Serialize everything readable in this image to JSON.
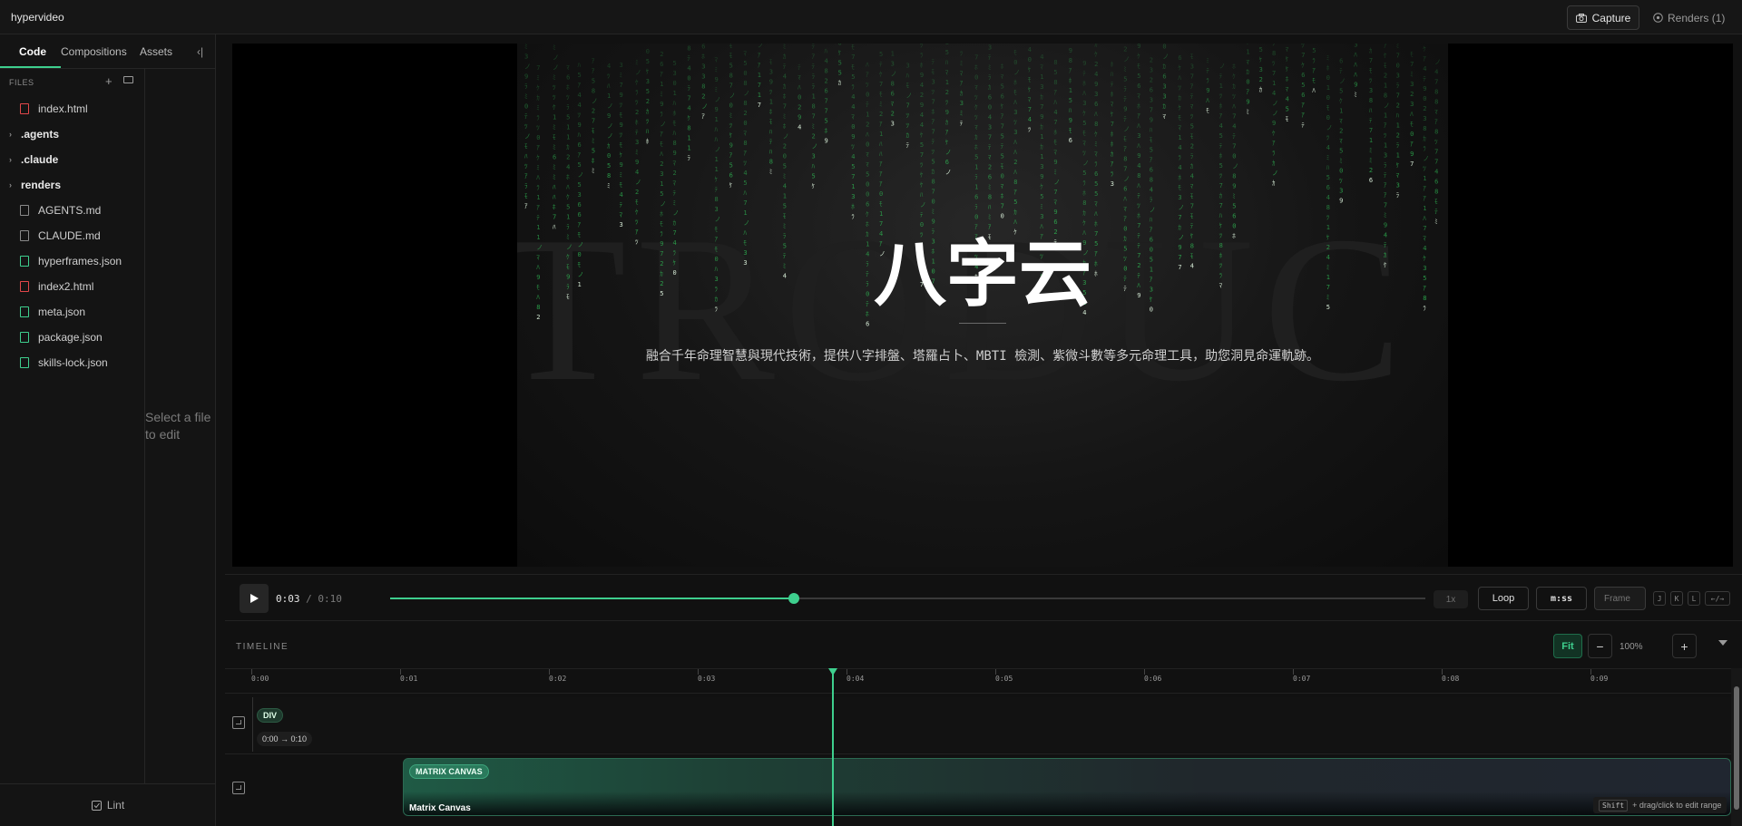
{
  "app": {
    "title": "hypervideo"
  },
  "header": {
    "capture_label": "Capture",
    "renders_label": "Renders (1)"
  },
  "sidebar": {
    "tabs": [
      {
        "label": "Code",
        "active": true
      },
      {
        "label": "Compositions",
        "active": false
      },
      {
        "label": "Assets",
        "active": false
      }
    ],
    "files_header": "FILES",
    "files": [
      {
        "name": "index.html",
        "kind": "html"
      },
      {
        "name": ".agents",
        "kind": "folder"
      },
      {
        "name": ".claude",
        "kind": "folder"
      },
      {
        "name": "renders",
        "kind": "folder"
      },
      {
        "name": "AGENTS.md",
        "kind": "md"
      },
      {
        "name": "CLAUDE.md",
        "kind": "md"
      },
      {
        "name": "hyperframes.json",
        "kind": "json"
      },
      {
        "name": "index2.html",
        "kind": "html"
      },
      {
        "name": "meta.json",
        "kind": "json"
      },
      {
        "name": "package.json",
        "kind": "json"
      },
      {
        "name": "skills-lock.json",
        "kind": "json"
      }
    ],
    "empty_editor_message": "Select a file to edit",
    "lint_label": "Lint"
  },
  "preview": {
    "background_word": "TRODUC",
    "heading": "八字云",
    "subtitle": "融合千年命理智慧與現代技術，提供八字排盤、塔羅占卜、MBTI 檢測、紫微斗數等多元命理工具，助您洞見命運軌跡。",
    "rain_glyphs": "5ノ7ｱｶﾊ012ﾐﾓ3ﾗ8ﾂ4ﾎﾃ69ﾏｹ"
  },
  "playback": {
    "current_time": "0:03",
    "separator": "/",
    "total_time": "0:10",
    "progress": 0.39,
    "speed": "1x",
    "loop_label": "Loop",
    "format_label": "m:ss",
    "frame_placeholder": "Frame",
    "shortcuts": [
      "J",
      "K",
      "L",
      "←/→"
    ]
  },
  "timeline": {
    "title": "TIMELINE",
    "fit_label": "Fit",
    "zoom_out": "−",
    "zoom_in": "+",
    "zoom_level": "100%",
    "ticks": [
      "0:00",
      "0:01",
      "0:02",
      "0:03",
      "0:04",
      "0:05",
      "0:06",
      "0:07",
      "0:08",
      "0:09"
    ],
    "playhead_seconds": 3.9,
    "tracks": [
      {
        "tag": "DIV",
        "range": "0:00 → 0:10"
      },
      {
        "tag": "MATRIX CANVAS",
        "label": "Matrix Canvas"
      }
    ],
    "hint_key": "Shift",
    "hint_text": "+ drag/click to edit range"
  },
  "colors": {
    "accent": "#3ecf8e",
    "html_icon": "#e2474a",
    "json_icon": "#3ecf8e"
  }
}
